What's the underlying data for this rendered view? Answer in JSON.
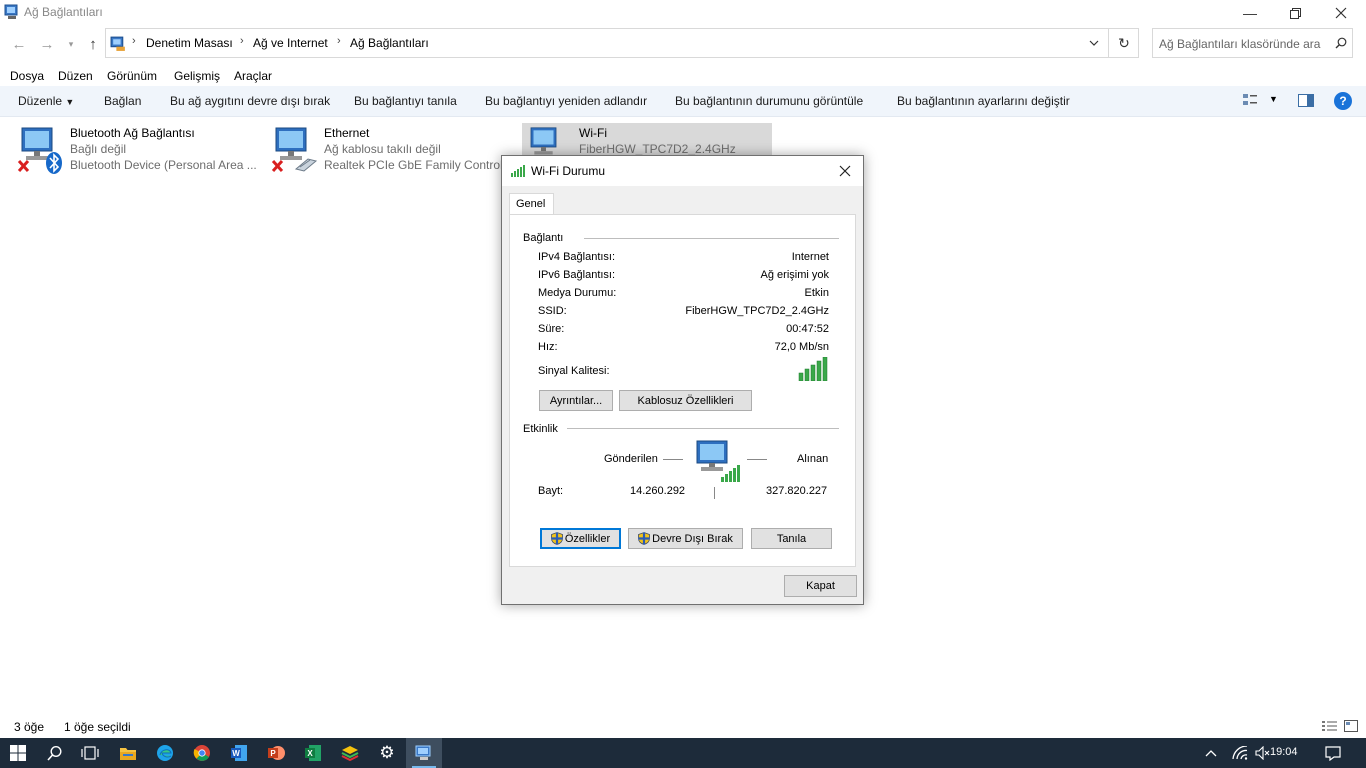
{
  "window": {
    "title": "Ağ Bağlantıları"
  },
  "address": {
    "breadcrumbs": [
      "Denetim Masası",
      "Ağ ve Internet",
      "Ağ Bağlantıları"
    ]
  },
  "search": {
    "placeholder": "Ağ Bağlantıları klasöründe ara"
  },
  "menu": [
    "Dosya",
    "Düzen",
    "Görünüm",
    "Gelişmiş",
    "Araçlar"
  ],
  "commands": {
    "organize": "Düzenle",
    "connect": "Bağlan",
    "disable": "Bu ağ aygıtını devre dışı bırak",
    "diagnose": "Bu bağlantıyı tanıla",
    "rename": "Bu bağlantıyı yeniden adlandır",
    "status": "Bu bağlantının durumunu görüntüle",
    "settings": "Bu bağlantının ayarlarını değiştir"
  },
  "connections": [
    {
      "name": "Bluetooth Ağ Bağlantısı",
      "status": "Bağlı değil",
      "device": "Bluetooth Device (Personal Area ..."
    },
    {
      "name": "Ethernet",
      "status": "Ağ kablosu takılı değil",
      "device": "Realtek PCIe GbE Family Controlle..."
    },
    {
      "name": "Wi-Fi",
      "status": "FiberHGW_TPC7D2_2.4GHz"
    }
  ],
  "dialog": {
    "title": "Wi-Fi Durumu",
    "tab": "Genel",
    "connection_group": "Bağlantı",
    "rows": [
      {
        "label": "IPv4 Bağlantısı:",
        "value": "Internet"
      },
      {
        "label": "IPv6 Bağlantısı:",
        "value": "Ağ erişimi yok"
      },
      {
        "label": "Medya Durumu:",
        "value": "Etkin"
      },
      {
        "label": "SSID:",
        "value": "FiberHGW_TPC7D2_2.4GHz"
      },
      {
        "label": "Süre:",
        "value": "00:47:52"
      },
      {
        "label": "Hız:",
        "value": "72,0 Mb/sn"
      }
    ],
    "signal_label": "Sinyal Kalitesi:",
    "signal_bars": 5,
    "details_button": "Ayrıntılar...",
    "wireless_props_button": "Kablosuz Özellikleri",
    "activity_group": "Etkinlik",
    "sent_label": "Gönderilen",
    "received_label": "Alınan",
    "bytes_label": "Bayt:",
    "bytes_sent": "14.260.292",
    "bytes_received": "327.820.227",
    "properties_button": "Özellikler",
    "disable_button": "Devre Dışı Bırak",
    "diagnose_button": "Tanıla",
    "close_button": "Kapat"
  },
  "status_bar": {
    "items_count": "3 öğe",
    "selected_count": "1 öğe seçildi"
  },
  "taskbar": {
    "time": "19:04"
  },
  "colors": {
    "accent": "#0078d7",
    "signal_green": "#3aa84a",
    "command_bar": "#f0f5fb",
    "taskbar": "#1d2b3a"
  }
}
